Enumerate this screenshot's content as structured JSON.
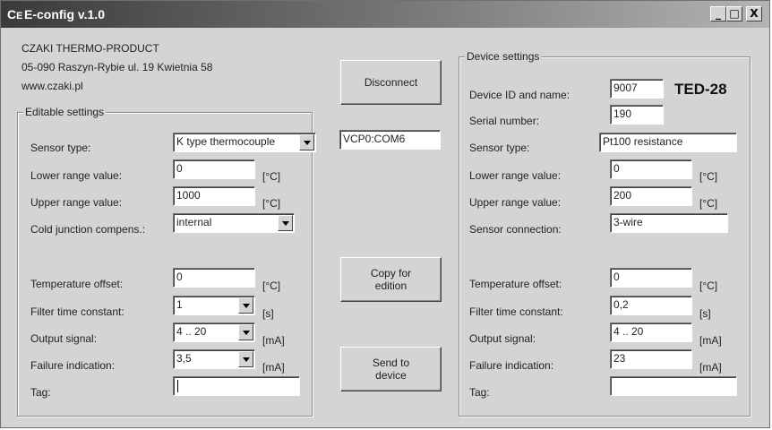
{
  "window": {
    "title": "E-config v.1.0",
    "app_icon": "ce-icon",
    "minimize": "_",
    "maximize": "□",
    "close": "X"
  },
  "company": {
    "name": "CZAKI THERMO-PRODUCT",
    "address": "05-090 Raszyn-Rybie ul. 19 Kwietnia 58",
    "website": "www.czaki.pl"
  },
  "editable": {
    "legend": "Editable settings",
    "sensor_type": {
      "label": "Sensor type:",
      "value": "K type thermocouple"
    },
    "lower_range": {
      "label": "Lower range value:",
      "value": "0",
      "unit": "[°C]"
    },
    "upper_range": {
      "label": "Upper range value:",
      "value": "1000",
      "unit": "[°C]"
    },
    "cold_junction": {
      "label": "Cold junction compens.:",
      "value": "internal"
    },
    "temp_offset": {
      "label": "Temperature offset:",
      "value": "0",
      "unit": "[°C]"
    },
    "filter": {
      "label": "Filter time constant:",
      "value": "1",
      "unit": "[s]"
    },
    "output": {
      "label": "Output signal:",
      "value": "4 .. 20",
      "unit": "[mA]"
    },
    "failure": {
      "label": "Failure indication:",
      "value": "3,5",
      "unit": "[mA]"
    },
    "tag": {
      "label": "Tag:",
      "value": ""
    }
  },
  "middle": {
    "disconnect": "Disconnect",
    "port": "VCP0:COM6",
    "copy": "Copy for\nedition",
    "send": "Send to\ndevice"
  },
  "device": {
    "legend": "Device settings",
    "id": {
      "label": "Device ID and name:",
      "value": "9007",
      "model": "TED-28"
    },
    "serial": {
      "label": "Serial number:",
      "value": "190"
    },
    "sensor_type": {
      "label": "Sensor type:",
      "value": "Pt100 resistance"
    },
    "lower_range": {
      "label": "Lower range value:",
      "value": "0",
      "unit": "[°C]"
    },
    "upper_range": {
      "label": "Upper range value:",
      "value": "200",
      "unit": "[°C]"
    },
    "connection": {
      "label": "Sensor connection:",
      "value": "3-wire"
    },
    "temp_offset": {
      "label": "Temperature offset:",
      "value": "0",
      "unit": "[°C]"
    },
    "filter": {
      "label": "Filter time constant:",
      "value": "0,2",
      "unit": "[s]"
    },
    "output": {
      "label": "Output signal:",
      "value": "4 .. 20",
      "unit": "[mA]"
    },
    "failure": {
      "label": "Failure indication:",
      "value": "23",
      "unit": "[mA]"
    },
    "tag": {
      "label": "Tag:",
      "value": ""
    }
  }
}
